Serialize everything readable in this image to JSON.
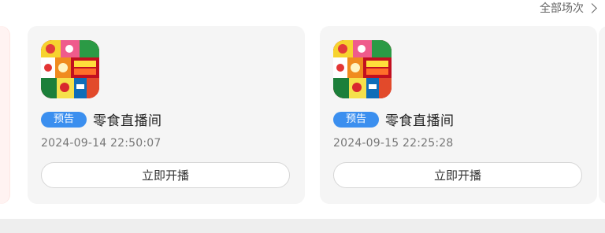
{
  "header": {
    "more_label": "全部场次"
  },
  "cards": [
    {
      "badge": "预告",
      "room_name": "零食直播间",
      "time": "2024-09-14 22:50:07",
      "button_label": "立即开播",
      "cover_icon": "snack-collage-thumbnail"
    },
    {
      "badge": "预告",
      "room_name": "零食直播间",
      "time": "2024-09-15 22:25:28",
      "button_label": "立即开播",
      "cover_icon": "snack-collage-thumbnail"
    }
  ],
  "colors": {
    "badge_bg": "#3b8fef",
    "card_bg": "#f5f5f5",
    "peek_card_bg": "#fff3f2"
  }
}
